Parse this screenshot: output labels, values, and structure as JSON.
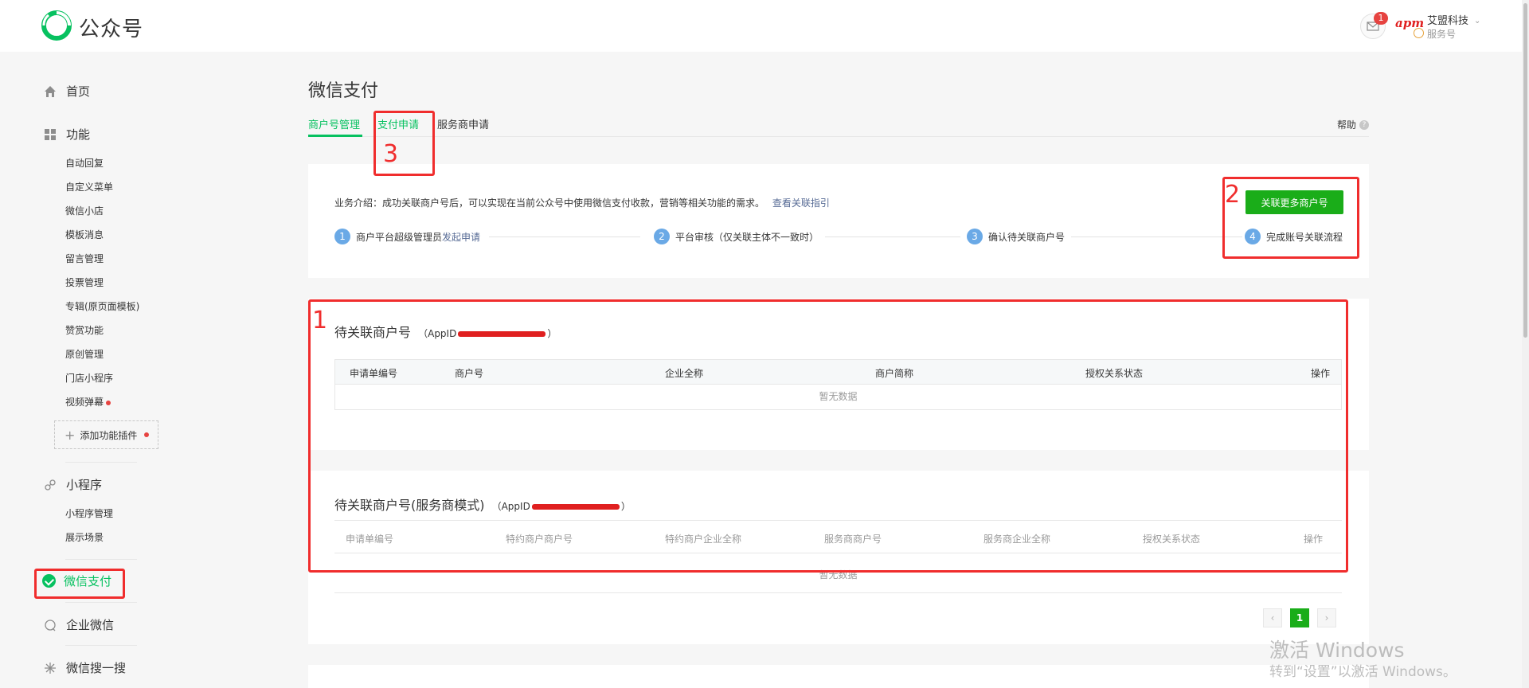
{
  "header": {
    "brand": "公众号",
    "mail_badge": "1",
    "account_logo": "apm",
    "account_name": "艾盟科技",
    "account_type": "服务号"
  },
  "sidebar": {
    "home": "首页",
    "functions": "功能",
    "function_items": [
      "自动回复",
      "自定义菜单",
      "微信小店",
      "模板消息",
      "留言管理",
      "投票管理",
      "专辑(原页面模板)",
      "赞赏功能",
      "原创管理",
      "门店小程序",
      "视频弹幕"
    ],
    "add_plugin": "添加功能插件",
    "miniprogram": "小程序",
    "miniprogram_items": [
      "小程序管理",
      "展示场景"
    ],
    "wechat_pay": "微信支付",
    "enterprise_wechat": "企业微信",
    "search": "微信搜一搜"
  },
  "main": {
    "title": "微信支付",
    "tabs": [
      "商户号管理",
      "支付申请",
      "服务商申请"
    ],
    "help": "帮助",
    "intro_text": "业务介绍：成功关联商户号后，可以实现在当前公众号中使用微信支付收款，营销等相关功能的需求。",
    "intro_link": "查看关联指引",
    "link_more_button": "关联更多商户号",
    "steps": [
      {
        "num": "1",
        "text": "商户平台超级管理员",
        "link": "发起申请"
      },
      {
        "num": "2",
        "text": "平台审核（仅关联主体不一致时）"
      },
      {
        "num": "3",
        "text": "确认待关联商户号"
      },
      {
        "num": "4",
        "text": "完成账号关联流程"
      }
    ],
    "section1": {
      "title": "待关联商户号",
      "appid_prefix": "（AppID",
      "appid_suffix": "）",
      "columns": [
        "申请单编号",
        "商户号",
        "企业全称",
        "商户简称",
        "授权关系状态",
        "操作"
      ],
      "empty": "暂无数据"
    },
    "section2": {
      "title": "待关联商户号(服务商模式)",
      "appid_prefix": "（AppID",
      "appid_suffix": "）",
      "columns": [
        "申请单编号",
        "特约商户商户号",
        "特约商户企业全称",
        "服务商商户号",
        "服务商企业全称",
        "授权关系状态",
        "操作"
      ],
      "empty": "暂无数据"
    },
    "pagination": {
      "prev": "‹",
      "current": "1",
      "next": "›"
    }
  },
  "annotations": [
    "1",
    "2",
    "3"
  ],
  "watermark": {
    "line1": "激活 Windows",
    "line2": "转到“设置”以激活 Windows。"
  },
  "colors": {
    "accent": "#07c160",
    "button": "#1aad19",
    "annotation": "#f02d2d",
    "link": "#576b95"
  }
}
